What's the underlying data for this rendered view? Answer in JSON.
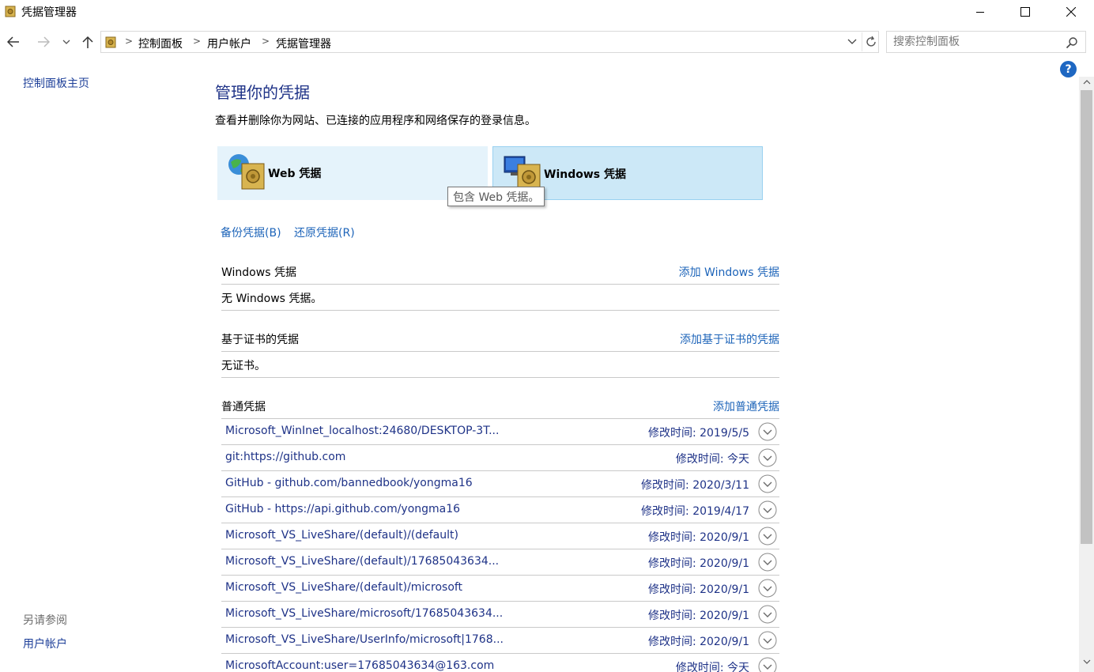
{
  "window": {
    "title": "凭据管理器"
  },
  "nav": {
    "breadcrumbs": [
      "控制面板",
      "用户帐户",
      "凭据管理器"
    ],
    "search_placeholder": "搜索控制面板"
  },
  "sidebar": {
    "home_link": "控制面板主页",
    "see_also_heading": "另请参阅",
    "see_also_links": [
      "用户帐户"
    ]
  },
  "main": {
    "title": "管理你的凭据",
    "description": "查看并删除你为网站、已连接的应用程序和网络保存的登录信息。",
    "tabs": [
      {
        "label": "Web 凭据",
        "icon": "globe-vault-icon",
        "selected": false
      },
      {
        "label": "Windows 凭据",
        "icon": "computer-vault-icon",
        "selected": true
      }
    ],
    "tooltip": "包含 Web 凭据。",
    "backup_link": "备份凭据(B)",
    "restore_link": "还原凭据(R)",
    "sections": {
      "windows": {
        "heading": "Windows 凭据",
        "add_link": "添加 Windows 凭据",
        "empty_text": "无 Windows 凭据。"
      },
      "certificate": {
        "heading": "基于证书的凭据",
        "add_link": "添加基于证书的凭据",
        "empty_text": "无证书。"
      },
      "generic": {
        "heading": "普通凭据",
        "add_link": "添加普通凭据",
        "items": [
          {
            "name": "Microsoft_WinInet_localhost:24680/DESKTOP-3T...",
            "modified": "修改时间:  2019/5/5"
          },
          {
            "name": "git:https://github.com",
            "modified": "修改时间:  今天"
          },
          {
            "name": "GitHub - github.com/bannedbook/yongma16",
            "modified": "修改时间:  2020/3/11"
          },
          {
            "name": "GitHub - https://api.github.com/yongma16",
            "modified": "修改时间:  2019/4/17"
          },
          {
            "name": "Microsoft_VS_LiveShare/(default)/(default)",
            "modified": "修改时间:  2020/9/1"
          },
          {
            "name": "Microsoft_VS_LiveShare/(default)/17685043634...",
            "modified": "修改时间:  2020/9/1"
          },
          {
            "name": "Microsoft_VS_LiveShare/(default)/microsoft",
            "modified": "修改时间:  2020/9/1"
          },
          {
            "name": "Microsoft_VS_LiveShare/microsoft/17685043634...",
            "modified": "修改时间:  2020/9/1"
          },
          {
            "name": "Microsoft_VS_LiveShare/UserInfo/microsoft|1768...",
            "modified": "修改时间:  2020/9/1"
          },
          {
            "name": "MicrosoftAccount:user=17685043634@163.com",
            "modified": "修改时间:  今天"
          }
        ]
      }
    }
  },
  "colors": {
    "link": "#1d64b9",
    "title": "#1e3287",
    "selected_tile": "#cce8f7",
    "unselected_tile": "#e5f3fb"
  }
}
